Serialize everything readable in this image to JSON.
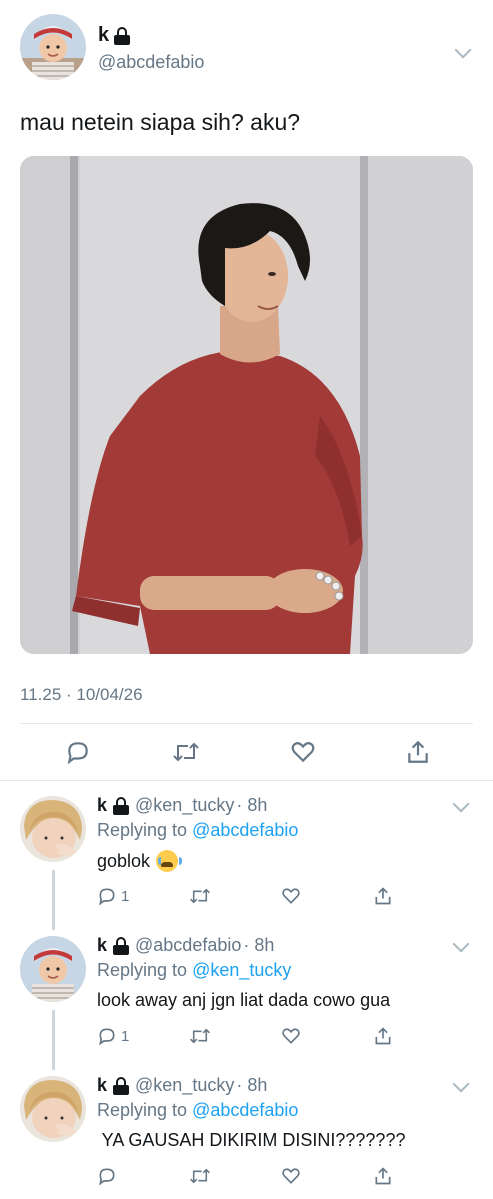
{
  "tweet": {
    "name": "k",
    "handle": "@abcdefabio",
    "text": "mau netein siapa sih? aku?",
    "timestamp": "11.25 · 10/04/26",
    "actions": [
      "reply-icon",
      "retweet-icon",
      "like-icon",
      "share-icon"
    ]
  },
  "replies": [
    {
      "name": "k",
      "handle": "@ken_tucky",
      "time": "· 8h",
      "replying_prefix": "Replying to",
      "replying_to": "@abcdefabio",
      "text": "goblok",
      "emoji": "loudly-crying-face-emoji",
      "reply_count": "1"
    },
    {
      "name": "k",
      "handle": "@abcdefabio",
      "time": "· 8h",
      "replying_prefix": "Replying to",
      "replying_to": "@ken_tucky",
      "text": "look away anj jgn liat dada cowo gua",
      "reply_count": "1"
    },
    {
      "name": "k",
      "handle": "@ken_tucky",
      "time": "· 8h",
      "replying_prefix": "Replying to",
      "replying_to": "@abcdefabio",
      "text": " YA GAUSAH DIKIRIM DISINI???????",
      "reply_count": ""
    }
  ],
  "colors": {
    "text": "#14171a",
    "secondary": "#657786",
    "link": "#1da1f2",
    "divider": "#e1e8ed",
    "shirt": "#a23a37"
  }
}
